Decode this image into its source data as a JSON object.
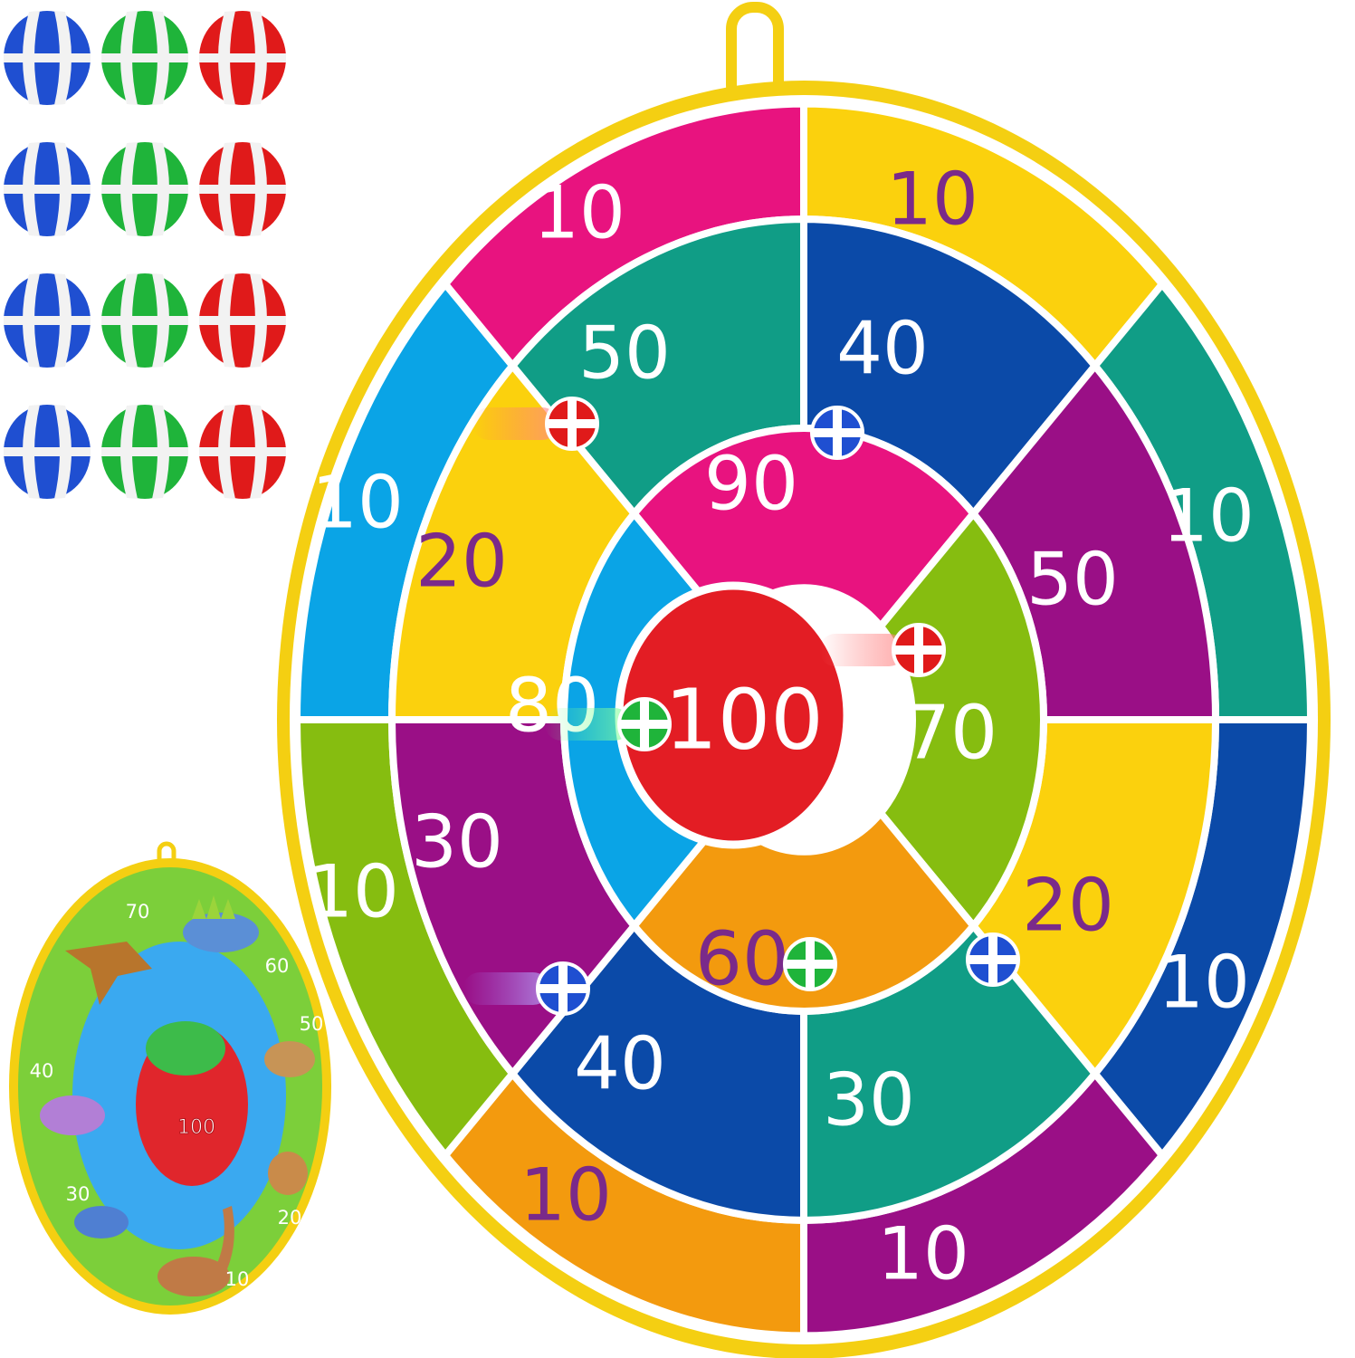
{
  "colors": {
    "rim": "#f4cf12",
    "magenta": "#e8137f",
    "yellow": "#fbd10d",
    "teal": "#109d86",
    "blue": "#0b4aa8",
    "purple": "#9a0f86",
    "sky": "#0aa4e6",
    "lime": "#86bd10",
    "orange": "#f39a0e",
    "red": "#e31d24",
    "white": "#ffffff",
    "purple_text": "#7a2a8a",
    "ball_blue": "#1f4fd1",
    "ball_green": "#1fb43a",
    "ball_red": "#e01a1a"
  },
  "main_board": {
    "bullseye": {
      "label": "100"
    },
    "outer_ring": [
      {
        "label": "10",
        "fill": "magenta",
        "text_color": "white"
      },
      {
        "label": "10",
        "fill": "yellow",
        "text_color": "purple_text"
      },
      {
        "label": "10",
        "fill": "teal",
        "text_color": "white"
      },
      {
        "label": "10",
        "fill": "blue",
        "text_color": "white"
      },
      {
        "label": "10",
        "fill": "purple",
        "text_color": "white"
      },
      {
        "label": "10",
        "fill": "orange",
        "text_color": "purple_text"
      },
      {
        "label": "10",
        "fill": "lime",
        "text_color": "white"
      },
      {
        "label": "10",
        "fill": "sky",
        "text_color": "white"
      }
    ],
    "middle_ring": [
      {
        "label": "50",
        "fill": "teal",
        "text_color": "white"
      },
      {
        "label": "40",
        "fill": "blue",
        "text_color": "white"
      },
      {
        "label": "50",
        "fill": "purple",
        "text_color": "white"
      },
      {
        "label": "20",
        "fill": "yellow",
        "text_color": "purple_text"
      },
      {
        "label": "30",
        "fill": "teal",
        "text_color": "white"
      },
      {
        "label": "40",
        "fill": "blue",
        "text_color": "white"
      },
      {
        "label": "30",
        "fill": "purple",
        "text_color": "white"
      },
      {
        "label": "20",
        "fill": "yellow",
        "text_color": "purple_text"
      }
    ],
    "inner_ring": [
      {
        "label": "90",
        "fill": "magenta",
        "text_color": "white"
      },
      {
        "label": "70",
        "fill": "lime",
        "text_color": "white"
      },
      {
        "label": "60",
        "fill": "orange",
        "text_color": "purple_text"
      },
      {
        "label": "80",
        "fill": "sky",
        "text_color": "white"
      }
    ]
  },
  "thrown_balls": [
    "red",
    "blue",
    "red",
    "green",
    "green",
    "blue",
    "blue"
  ],
  "ball_grid": [
    "blue",
    "green",
    "red"
  ],
  "ball_grid_rows": 4,
  "dino_board": {
    "bullseye_label": "100",
    "labels": [
      "70",
      "60",
      "50",
      "40",
      "30",
      "20",
      "10"
    ]
  }
}
